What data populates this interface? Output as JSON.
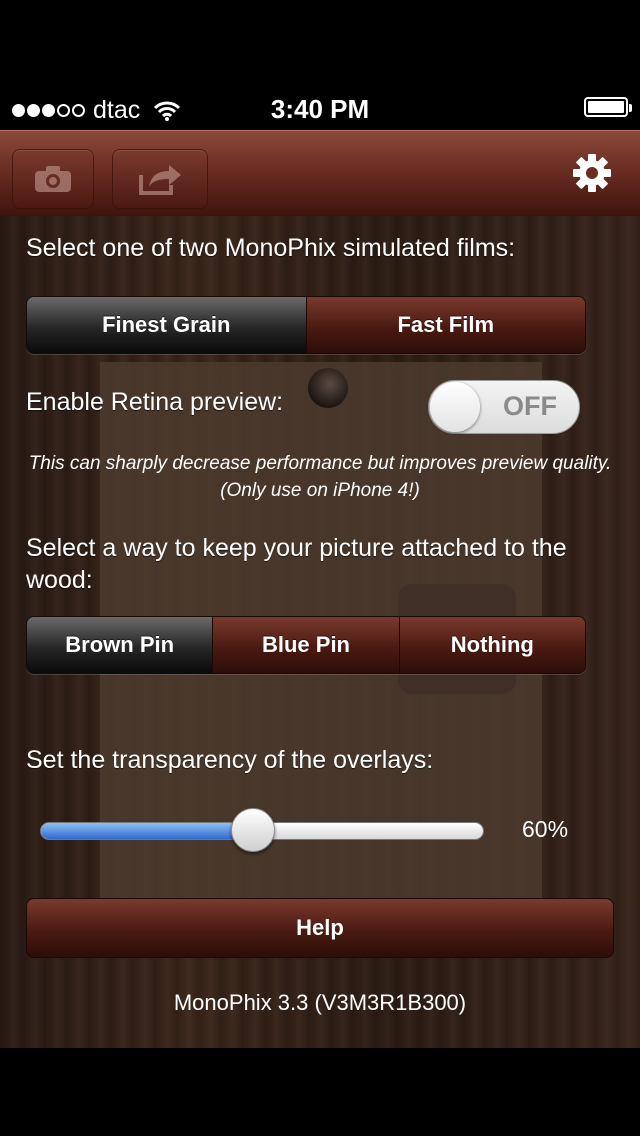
{
  "status_bar": {
    "carrier": "dtac",
    "time": "3:40 PM",
    "signal_bars_filled": 3,
    "signal_bars_total": 5
  },
  "toolbar": {
    "camera_icon": "camera-icon",
    "share_icon": "share-icon",
    "settings_icon": "gear-icon"
  },
  "films": {
    "label": "Select one of two MonoPhix simulated films:",
    "options": [
      "Finest Grain",
      "Fast Film"
    ],
    "selected": "Finest Grain"
  },
  "retina": {
    "label": "Enable Retina preview:",
    "toggle_text": "OFF",
    "state": false,
    "note": "This can sharply decrease performance but improves preview quality. (Only use on iPhone 4!)"
  },
  "attach": {
    "label": "Select a way to keep your picture attached to the wood:",
    "options": [
      "Brown Pin",
      "Blue Pin",
      "Nothing"
    ],
    "selected": "Brown Pin"
  },
  "transparency": {
    "label": "Set the transparency of the overlays:",
    "value_text": "60%",
    "value": 0.6
  },
  "help_button": "Help",
  "version": "MonoPhix 3.3 (V3M3R1B300)",
  "colors": {
    "accent_brown": "#6a2d22",
    "slider_blue": "#2f6bd0"
  }
}
